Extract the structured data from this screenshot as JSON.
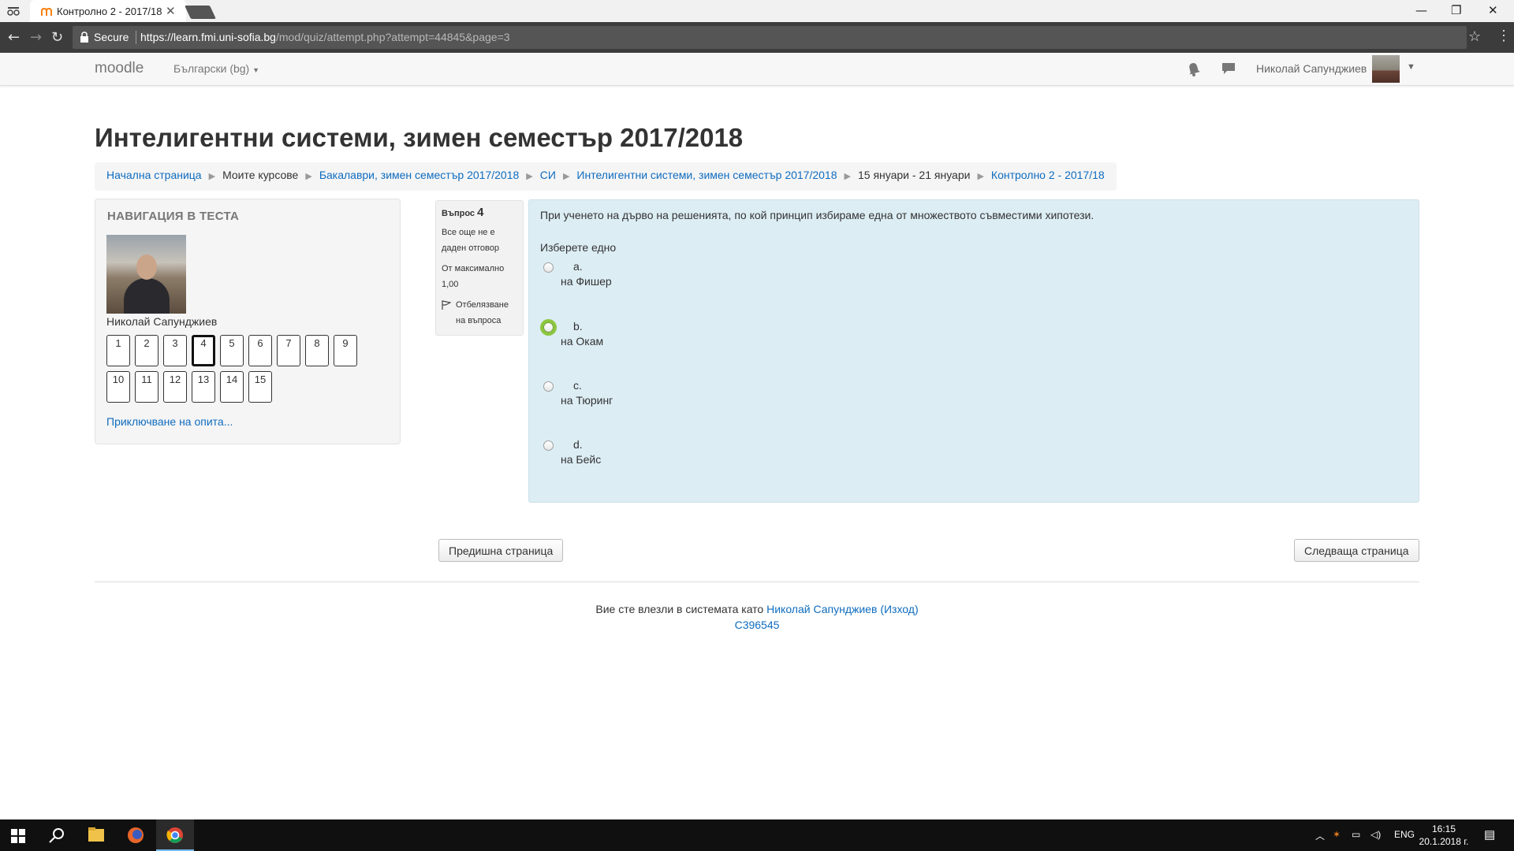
{
  "browser": {
    "tab_title": "Контролно 2 - 2017/18",
    "secure_label": "Secure",
    "url_domain": "https://learn.fmi.uni-sofia.bg",
    "url_path": "/mod/quiz/attempt.php?attempt=44845&page=3"
  },
  "navbar": {
    "brand": "moodle",
    "language": "Български (bg)",
    "user_name": "Николай Сапунджиев"
  },
  "page": {
    "title": "Интелигентни системи, зимен семестър 2017/2018"
  },
  "breadcrumb": [
    {
      "label": "Начална страница",
      "link": true
    },
    {
      "label": "Моите курсове",
      "link": false
    },
    {
      "label": "Бакалаври, зимен семестър 2017/2018",
      "link": true
    },
    {
      "label": "СИ",
      "link": true
    },
    {
      "label": "Интелигентни системи, зимен семестър 2017/2018",
      "link": true
    },
    {
      "label": "15 януари - 21 януари",
      "link": false
    },
    {
      "label": "Контролно 2 - 2017/18",
      "link": true
    }
  ],
  "quiz_nav": {
    "title": "НАВИГАЦИЯ В ТЕСТА",
    "user_name": "Николай Сапунджиев",
    "buttons": [
      "1",
      "2",
      "3",
      "4",
      "5",
      "6",
      "7",
      "8",
      "9",
      "10",
      "11",
      "12",
      "13",
      "14",
      "15"
    ],
    "current": "4",
    "finish_link": "Приключване на опита..."
  },
  "question_info": {
    "label": "Въпрос",
    "number": "4",
    "status": "Все още не е даден отговор",
    "marks": "От максимално 1,00",
    "flag_label": "Отбелязване на въпроса"
  },
  "question": {
    "text": "При ученето на дърво на решенията, по кой принцип избираме една от множеството съвместими хипотези.",
    "prompt": "Изберете едно",
    "options": [
      {
        "letter": "a.",
        "answer": "на Фишер"
      },
      {
        "letter": "b.",
        "answer": "на Окам"
      },
      {
        "letter": "c.",
        "answer": "на Тюринг"
      },
      {
        "letter": "d.",
        "answer": "на Бейс"
      }
    ]
  },
  "buttons": {
    "prev": "Предишна страница",
    "next": "Следваща страница"
  },
  "footer": {
    "logged_in_text": "Вие сте влезли в системата като",
    "user_link": "Николай Сапунджиев",
    "logout": "(Изход)",
    "code": "C396545"
  },
  "taskbar": {
    "lang": "ENG",
    "time": "16:15",
    "date": "20.1.2018 г."
  },
  "colors": {
    "link": "#0f6cbf",
    "question_bg": "#dcedf4",
    "focus_ring": "#8dc63f"
  }
}
